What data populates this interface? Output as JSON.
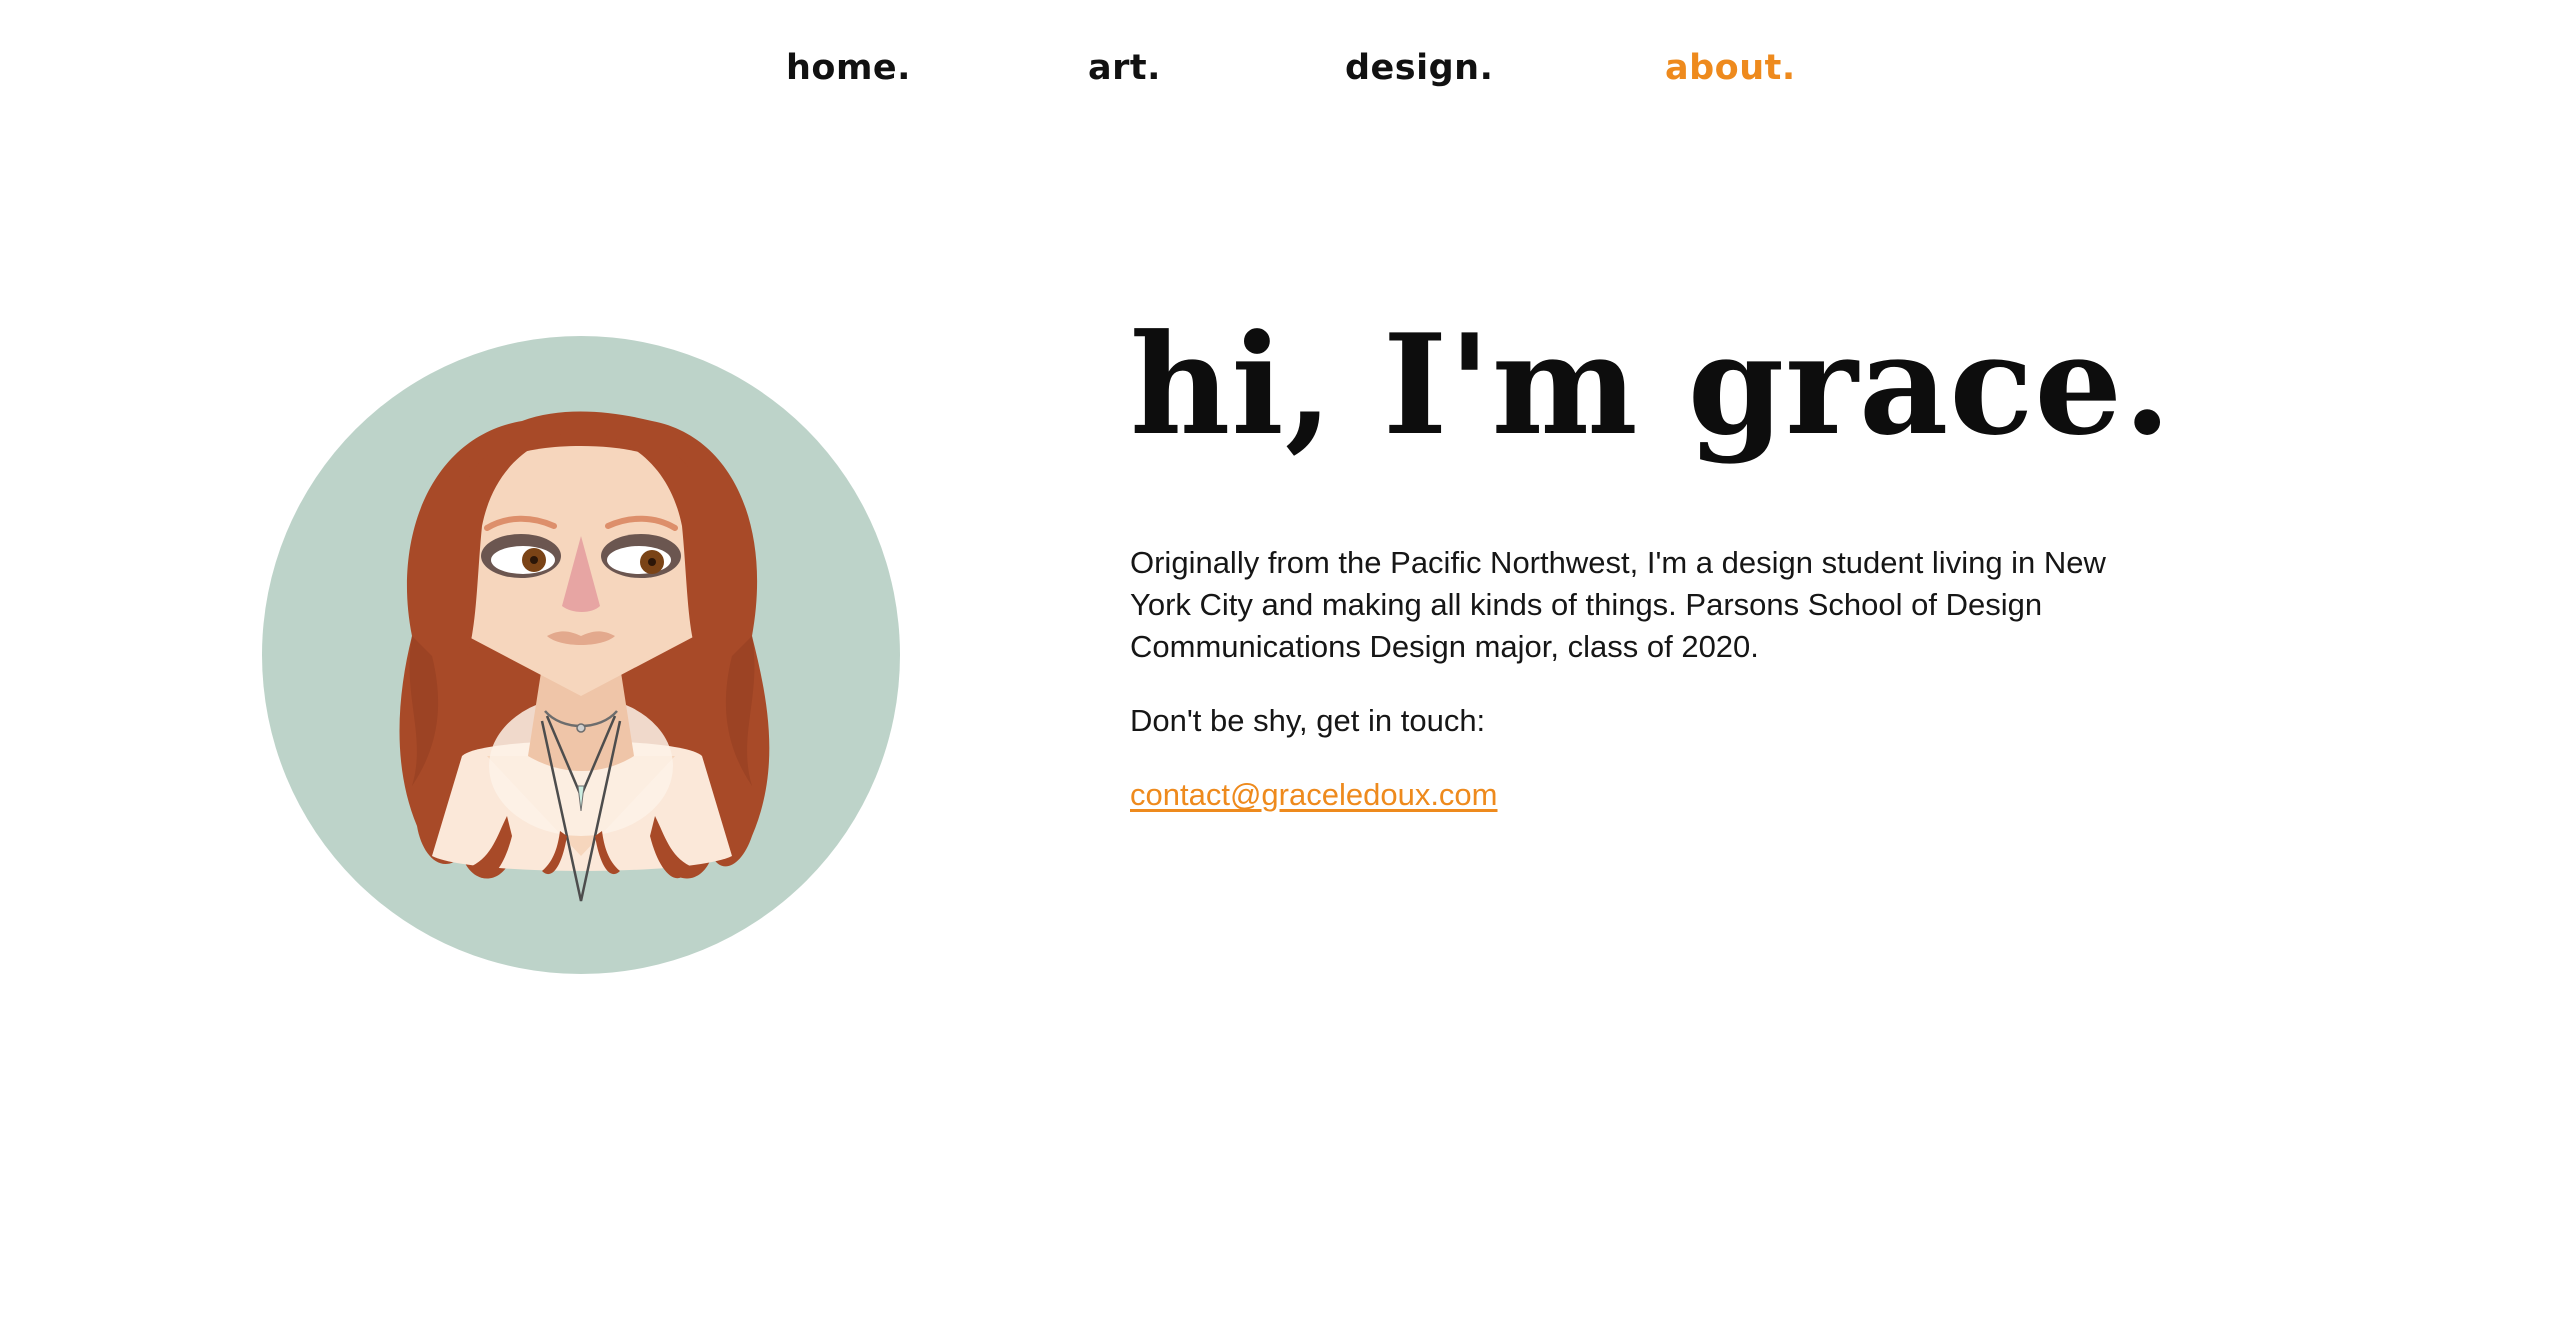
{
  "nav": {
    "items": [
      {
        "label": "home."
      },
      {
        "label": "art."
      },
      {
        "label": "design."
      },
      {
        "label": "about."
      }
    ],
    "active_index": 3,
    "accent_color": "#ee8a1d"
  },
  "avatar": {
    "description_icon": "portrait-illustration-icon",
    "background_color": "#bdd3c9",
    "hair_color": "#a84a28"
  },
  "intro": {
    "heading": "hi, I'm grace.",
    "bio": "Originally from the Pacific Northwest, I'm a design student living in New York City and making all kinds of things. Parsons School of Design Communications Design major, class of 2020.",
    "cta": "Don't be shy, get in touch:",
    "email": "contact@graceledoux.com"
  }
}
